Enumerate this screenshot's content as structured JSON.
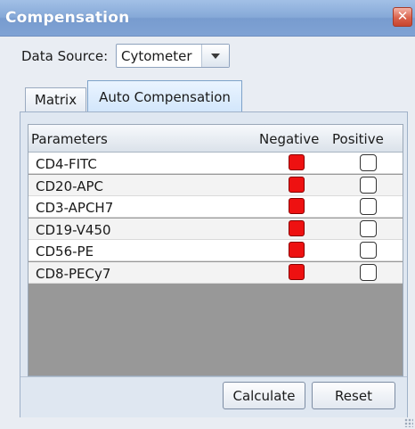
{
  "window": {
    "title": "Compensation",
    "close_glyph": "✕"
  },
  "data_source": {
    "label": "Data Source:",
    "value": "Cytometer"
  },
  "tabs": [
    {
      "label": "Matrix",
      "active": false
    },
    {
      "label": "Auto Compensation",
      "active": true
    }
  ],
  "grid": {
    "headers": {
      "parameters": "Parameters",
      "negative": "Negative",
      "positive": "Positive"
    },
    "rows": [
      {
        "name": "CD4-FITC",
        "negative": true,
        "positive": false
      },
      {
        "name": "CD20-APC",
        "negative": true,
        "positive": false
      },
      {
        "name": "CD3-APCH7",
        "negative": true,
        "positive": false
      },
      {
        "name": "CD19-V450",
        "negative": true,
        "positive": false
      },
      {
        "name": "CD56-PE",
        "negative": true,
        "positive": false
      },
      {
        "name": "CD8-PECy7",
        "negative": true,
        "positive": false
      }
    ]
  },
  "buttons": {
    "calculate": "Calculate",
    "reset": "Reset"
  },
  "colors": {
    "negative_fill": "#ee1111",
    "titlebar": "#86a9d8"
  }
}
